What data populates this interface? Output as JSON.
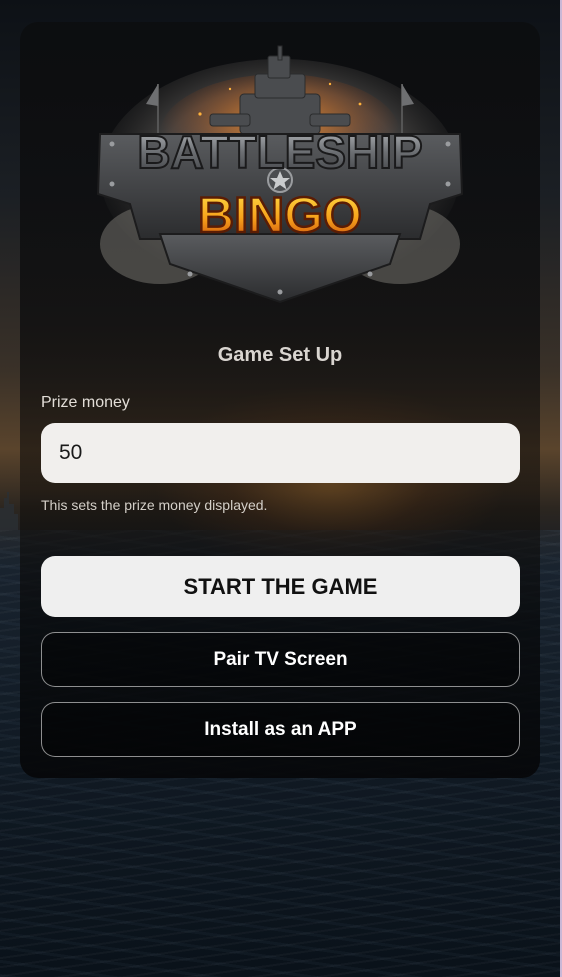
{
  "logo": {
    "line1": "BATTLESHIP",
    "line2": "BINGO"
  },
  "setup": {
    "title": "Game Set Up",
    "prize_label": "Prize money",
    "prize_value": "50",
    "prize_hint": "This sets the prize money displayed."
  },
  "buttons": {
    "start": "START THE GAME",
    "pair": "Pair TV Screen",
    "install": "Install as an APP"
  },
  "colors": {
    "logo_metal": "#8f9296",
    "logo_fire": "#f7a21b",
    "primary_button": "#efefef",
    "input_background": "#f1efed"
  }
}
